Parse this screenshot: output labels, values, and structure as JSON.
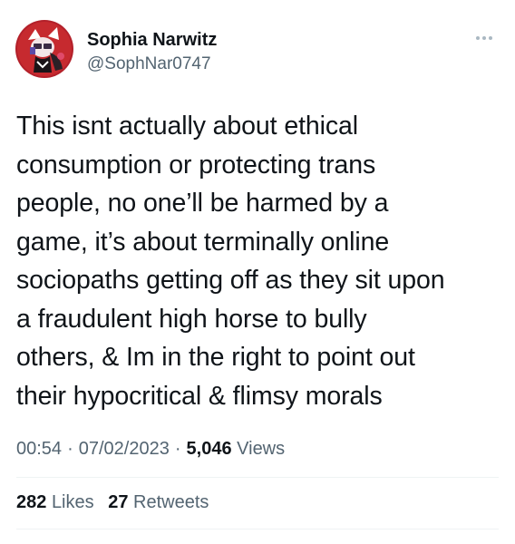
{
  "author": {
    "display_name": "Sophia Narwitz",
    "handle": "@SophNar0747",
    "avatar_icon": "profile-avatar"
  },
  "more_icon": "more-horizontal-icon",
  "tweet": {
    "lines": [
      "This isnt actually about ethical",
      "consumption or protecting trans",
      "people, no one’ll be harmed by a",
      "game, it’s about terminally online",
      "sociopaths getting off as they sit upon",
      "a fraudulent high horse to bully",
      "others, & Im in the right to point out",
      "their hypocritical & flimsy morals"
    ]
  },
  "meta": {
    "time": "00:54",
    "date": "07/02/2023",
    "views_count": "5,046",
    "views_label": "Views",
    "separator": "·"
  },
  "stats": {
    "likes_count": "282",
    "likes_label": "Likes",
    "retweets_count": "27",
    "retweets_label": "Retweets"
  },
  "colors": {
    "text_primary": "#0f1419",
    "text_secondary": "#536471",
    "divider": "#eff3f4"
  }
}
